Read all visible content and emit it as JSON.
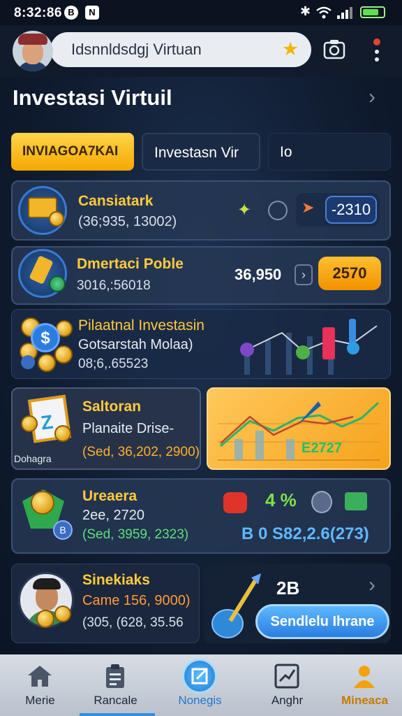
{
  "status_bar": {
    "time": "8:32:86",
    "icon_1": "B",
    "icon_2": "N",
    "wifi_icon": "wifi-icon",
    "signal_icon": "signal-icon"
  },
  "header": {
    "search_text": "Idsnnldsdgj Virtuan",
    "star_icon": "star-icon",
    "camera_icon": "camera-icon",
    "more_icon": "more-vertical-icon"
  },
  "page": {
    "title": "Investasi Virtuil"
  },
  "tabs": [
    {
      "label": "INVIAGOA7KAI",
      "active": true
    },
    {
      "label": "Investasn Vir"
    },
    {
      "label": "Io"
    }
  ],
  "cards": {
    "c1": {
      "title": "Cansiatark",
      "value": "(36;935, 13002)",
      "pill": "-2310"
    },
    "c2": {
      "title": "Dmertaci Poble",
      "value": "3016,:56018",
      "amount": "36,950",
      "button": "2570"
    },
    "c3": {
      "title": "Pilaatnal Investasin",
      "subtitle": "Gotsarstah Molaa)",
      "value": "08;6,.65523"
    },
    "c4": {
      "title": "Saltoran",
      "subtitle": "Planaite Drise-",
      "value": "(Sed, 36,202, 2900)",
      "badge": "Dohagra"
    },
    "c5": {
      "value": "E2727"
    },
    "c6": {
      "title": "Ureaera",
      "subtitle": "2ee, 2720",
      "value": "(Sed, 3959, 2323)",
      "percent": "4 %",
      "amount": "B 0  S82,2.6(273)"
    },
    "c7": {
      "title": "Sinekiaks",
      "subtitle": "Came 156, 9000)",
      "value": "(305, (628, 35.56",
      "count": "2B",
      "button": "Sendlelu Ihrane"
    }
  },
  "bottom_nav": [
    {
      "label": "Merie",
      "icon": "home-icon"
    },
    {
      "label": "Rancale",
      "icon": "clipboard-icon"
    },
    {
      "label": "Nonegis",
      "icon": "edit-icon",
      "active": true
    },
    {
      "label": "Anghr",
      "icon": "chart-icon"
    },
    {
      "label": "Mineaca",
      "icon": "user-icon"
    }
  ],
  "colors": {
    "accent": "#f5a800",
    "bg": "#101c30",
    "active_nav": "#2f8ee0"
  }
}
